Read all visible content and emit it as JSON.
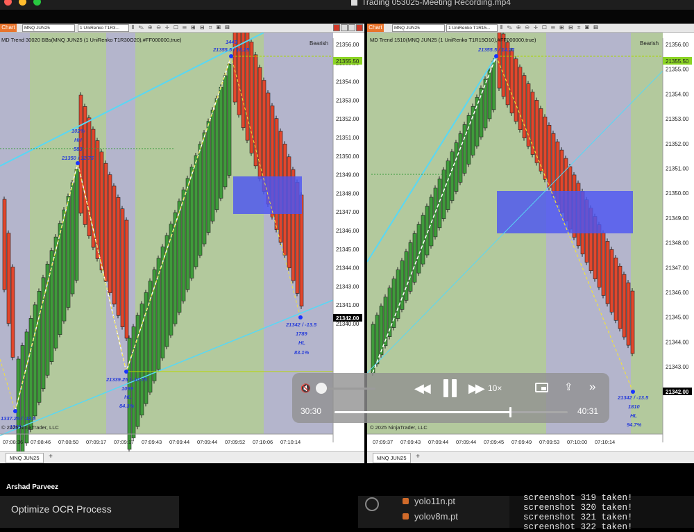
{
  "window": {
    "title": "Trading 053025-Meeting Recording.mp4"
  },
  "colors": {
    "bull": "#3e9b3a",
    "bear": "#e2462c",
    "zone": "#4d55f2",
    "cyan": "#58d8f5",
    "accent": "#e8742c"
  },
  "left_chart": {
    "toolbar": {
      "chart_btn": "Chart",
      "instrument": "MNQ JUN25",
      "bartype": "1 UniRenko T1R3..."
    },
    "indicator_title": "MD Trend 30020 BBs(MNQ JUN25 (1 UniRenko T1R30O20),#FF000000,true)",
    "trend_label": "Bearish",
    "current_price": "21355.50",
    "last_price": "21342.00",
    "prices": [
      "21356.00",
      "21355.00",
      "21354.00",
      "21353.00",
      "21352.00",
      "21351.00",
      "21350.00",
      "21349.00",
      "21348.00",
      "21347.00",
      "21346.00",
      "21345.00",
      "21344.00",
      "21343.00",
      "21341.00",
      "21340.00"
    ],
    "times": [
      "07:08:36",
      "07:08:46",
      "07:08:50",
      "07:09:17",
      "07:09:17",
      "07:09:43",
      "07:09:44",
      "07:09:44",
      "07:09:52",
      "07:10:06",
      "07:10:14"
    ],
    "copyright": "© 2025 NinjaTrader, LLC",
    "swing_labels": {
      "top1": "1443",
      "top2": "21355.5 / 16.25",
      "mid1": "102%",
      "mid2": "HH",
      "mid3": "583",
      "mid4": "21350 / 12.75",
      "low1": "21339.25 / -10.75",
      "low2": "1099",
      "low3": "HL",
      "low4": "84.3%",
      "ll1": "1337.25 / -12.5",
      "ll2": "1339",
      "end1": "21342 / -13.5",
      "end2": "1789",
      "end3": "HL",
      "end4": "83.1%"
    },
    "tab": "MNQ JUN25"
  },
  "right_chart": {
    "toolbar": {
      "chart_btn": "Chart",
      "instrument": "MNQ JUN25",
      "bartype": "1 UniRenko T1R15..."
    },
    "indicator_title": "MD Trend 1510(MNQ JUN25 (1 UniRenko T1R15O10),#FF000000,true)",
    "trend_label": "Bearish",
    "current_price": "21355.50",
    "last_price": "21342.00",
    "prices": [
      "21356.00",
      "21355.00",
      "21354.00",
      "21353.00",
      "21352.00",
      "21351.00",
      "21350.00",
      "21349.00",
      "21348.00",
      "21347.00",
      "21346.00",
      "21345.00",
      "21344.00",
      "21343.00",
      "21341.00"
    ],
    "times": [
      "07:09:37",
      "07:09:43",
      "07:09:44",
      "07:09:44",
      "07:09:45",
      "07:09:49",
      "07:09:53",
      "07:10:00",
      "07:10:14"
    ],
    "copyright": "© 2025 NinjaTrader, LLC",
    "swing_labels": {
      "top1": "21355.5 / 14.25",
      "end1": "21342 / -13.5",
      "end2": "1810",
      "end3": "HL",
      "end4": "94.7%"
    },
    "tab": "MNQ JUN25"
  },
  "player": {
    "speed": "10×",
    "current_time": "30:30",
    "duration": "40:31",
    "progress": 0.753,
    "volume": 0.0,
    "icons": {
      "mute": "speaker-muted-icon",
      "rewind": "rewind-icon",
      "pause": "pause-icon",
      "forward": "fast-forward-icon",
      "airplay": "airplay-icon",
      "share": "share-icon",
      "more": "more-icon"
    }
  },
  "presenter": "Arshad Parveez",
  "sidebar": {
    "item": "Optimize OCR Process"
  },
  "files": [
    "yolo11n.pt",
    "yolov8m.pt"
  ],
  "terminal": {
    "lines": [
      "screenshot 319 taken!",
      "screenshot 320 taken!",
      "screenshot 321 taken!",
      "screenshot 322 taken!"
    ]
  }
}
